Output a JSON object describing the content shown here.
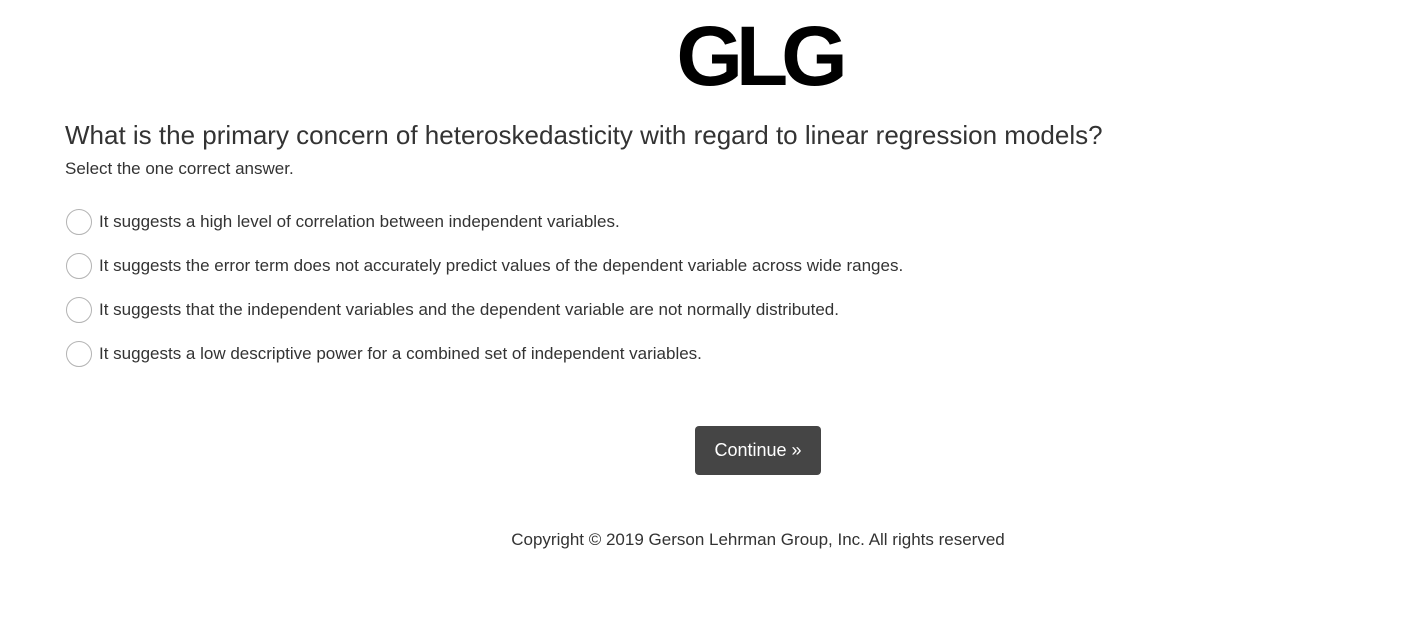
{
  "header": {
    "logo_text": "GLG"
  },
  "question": {
    "title": "What is the primary concern of heteroskedasticity with regard to linear regression models?",
    "instruction": "Select the one correct answer.",
    "options": [
      {
        "label": "It suggests a high level of correlation between independent variables.",
        "selected": false
      },
      {
        "label": "It suggests the error term does not accurately predict values of the dependent variable across wide ranges.",
        "selected": false
      },
      {
        "label": "It suggests that the independent variables and the dependent variable are not normally distributed.",
        "selected": false
      },
      {
        "label": "It suggests a low descriptive power for a combined set of independent variables.",
        "selected": false
      }
    ]
  },
  "actions": {
    "continue_label": "Continue »"
  },
  "footer": {
    "copyright": "Copyright © 2019 Gerson Lehrman Group, Inc. All rights reserved"
  },
  "colors": {
    "text": "#333333",
    "button_bg": "#454545",
    "button_text": "#ffffff",
    "radio_border": "#b3b3b3",
    "logo": "#000000"
  }
}
